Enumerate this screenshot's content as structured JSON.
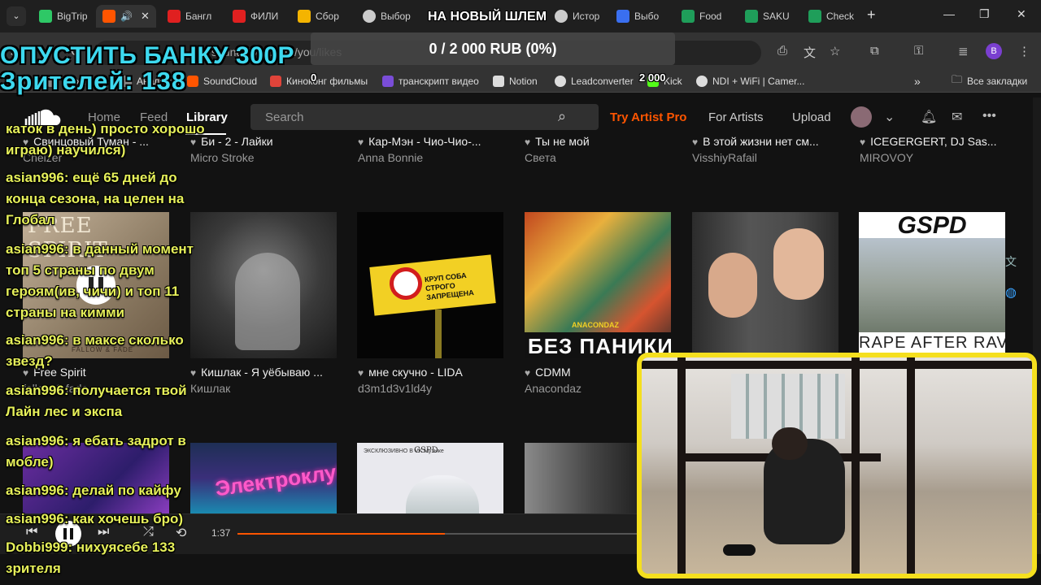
{
  "browser": {
    "tabs": [
      {
        "label": "BigTrip",
        "color": "#2ec866"
      },
      {
        "label": "",
        "color": "#ff5500",
        "active": true
      },
      {
        "label": "Бангл",
        "color": "#e02020"
      },
      {
        "label": "ФИЛИ",
        "color": "#e02020"
      },
      {
        "label": "Сбор",
        "color": "#f4b400"
      },
      {
        "label": "Выбор",
        "color": "#cccccc"
      },
      {
        "label": "Истор",
        "color": "#cccccc"
      },
      {
        "label": "Выбо",
        "color": "#3a6ff0"
      },
      {
        "label": "Food",
        "color": "#1f9e5a"
      },
      {
        "label": "SAKU",
        "color": "#1f9e5a"
      },
      {
        "label": "Check",
        "color": "#1f9e5a"
      }
    ],
    "url": "soundcloud.com/you/likes",
    "profile_initial": "B",
    "bookmarks": [
      {
        "label": "CrixxGо",
        "color": "#888888"
      },
      {
        "label": "Аналитика",
        "color": "#888888"
      },
      {
        "label": "SoundCloud",
        "color": "#ff5500"
      },
      {
        "label": "Киноконг фильмы",
        "color": "#e0443a"
      },
      {
        "label": "транскрипт видео",
        "color": "#7a4dd8"
      },
      {
        "label": "Notion",
        "color": "#dddddd"
      },
      {
        "label": "Leadconverter",
        "color": "#dddddd"
      },
      {
        "label": "Kick",
        "color": "#53fc18"
      },
      {
        "label": "NDI + WiFi | Camer...",
        "color": "#dddddd"
      }
    ],
    "all_bookmarks_label": "Все закладки"
  },
  "soundcloud": {
    "nav": {
      "home": "Home",
      "feed": "Feed",
      "library": "Library"
    },
    "search_placeholder": "Search",
    "try_pro": "Try Artist Pro",
    "for_artists": "For Artists",
    "upload": "Upload",
    "row1": [
      {
        "title": "Свинцовый Туман - ...",
        "artist": "Chelzer"
      },
      {
        "title": "Би - 2 - Лайки",
        "artist": "Micro Stroke"
      },
      {
        "title": "Кар-Мэн - Чио-Чио-...",
        "artist": "Anna Bonnie"
      },
      {
        "title": "Ты не мой",
        "artist": "Света"
      },
      {
        "title": "В этой жизни нет см...",
        "artist": "VisshiyRafail"
      },
      {
        "title": "ICEGERGERT, DJ Sas...",
        "artist": "MIROVOY"
      }
    ],
    "row2": [
      {
        "title": "Free Spirit",
        "artist": "fallow & fade"
      },
      {
        "title": "Кишлак - Я уёбываю ...",
        "artist": "Кишлак"
      },
      {
        "title": "мне скучно - LIDA",
        "artist": "d3m1d3v1ld4y"
      },
      {
        "title": "CDMM",
        "artist": "Anacondaz"
      },
      {
        "title": "",
        "artist": ""
      },
      {
        "title": "",
        "artist": ""
      }
    ],
    "covers": {
      "free_spirit_title": "FREE SPIRIT",
      "free_spirit_bottom": "FALLOW & FADE",
      "sign_text": "КРУП СОБА СТРОГО ЗАПРЕЩЕНА",
      "anacondaz_small": "ANACONDAZ",
      "anacondaz_title": "БЕЗ ПАНИКИ",
      "gspd_title": "GSPD",
      "gspd_bottom": "RAPE AFTER RAVE",
      "elektroklub": "Электроклуб",
      "vk_badge": "ЭКСКЛЮЗИВНО В VK Музыке",
      "gspd_small": "GSPD"
    }
  },
  "player": {
    "time": "1:37",
    "progress": 0.51
  },
  "overlay": {
    "bank": "ОПУСТИТЬ БАНКУ 300Р",
    "viewers": "Зрителей: 138",
    "helmet": "НА НОВЫЙ ШЛЕМ",
    "donation": "0 / 2 000 RUB (0%)",
    "zero": "0",
    "goal_small": "2 000"
  },
  "chat": [
    "катoк в день) просто хорошо",
    "играю) научился)",
    "asian996: ещё 65 дней до",
    "конца сезона, на целен на",
    "Глобал",
    "asian996: в данный момент",
    "топ 5 страны по двум",
    "героям(ив, чичи) и топ 11",
    "страны на кимми",
    "asian996: в максе сколько",
    "звезд?",
    "asian996: получается твой",
    "Лайн лес и экспа",
    "asian996: я ебать задрот в",
    "мобле)",
    "asian996: делай по кайфу",
    "asian996: как хочешь бро)",
    "Dobbi999: нихуясебе 133",
    "зрителя"
  ]
}
